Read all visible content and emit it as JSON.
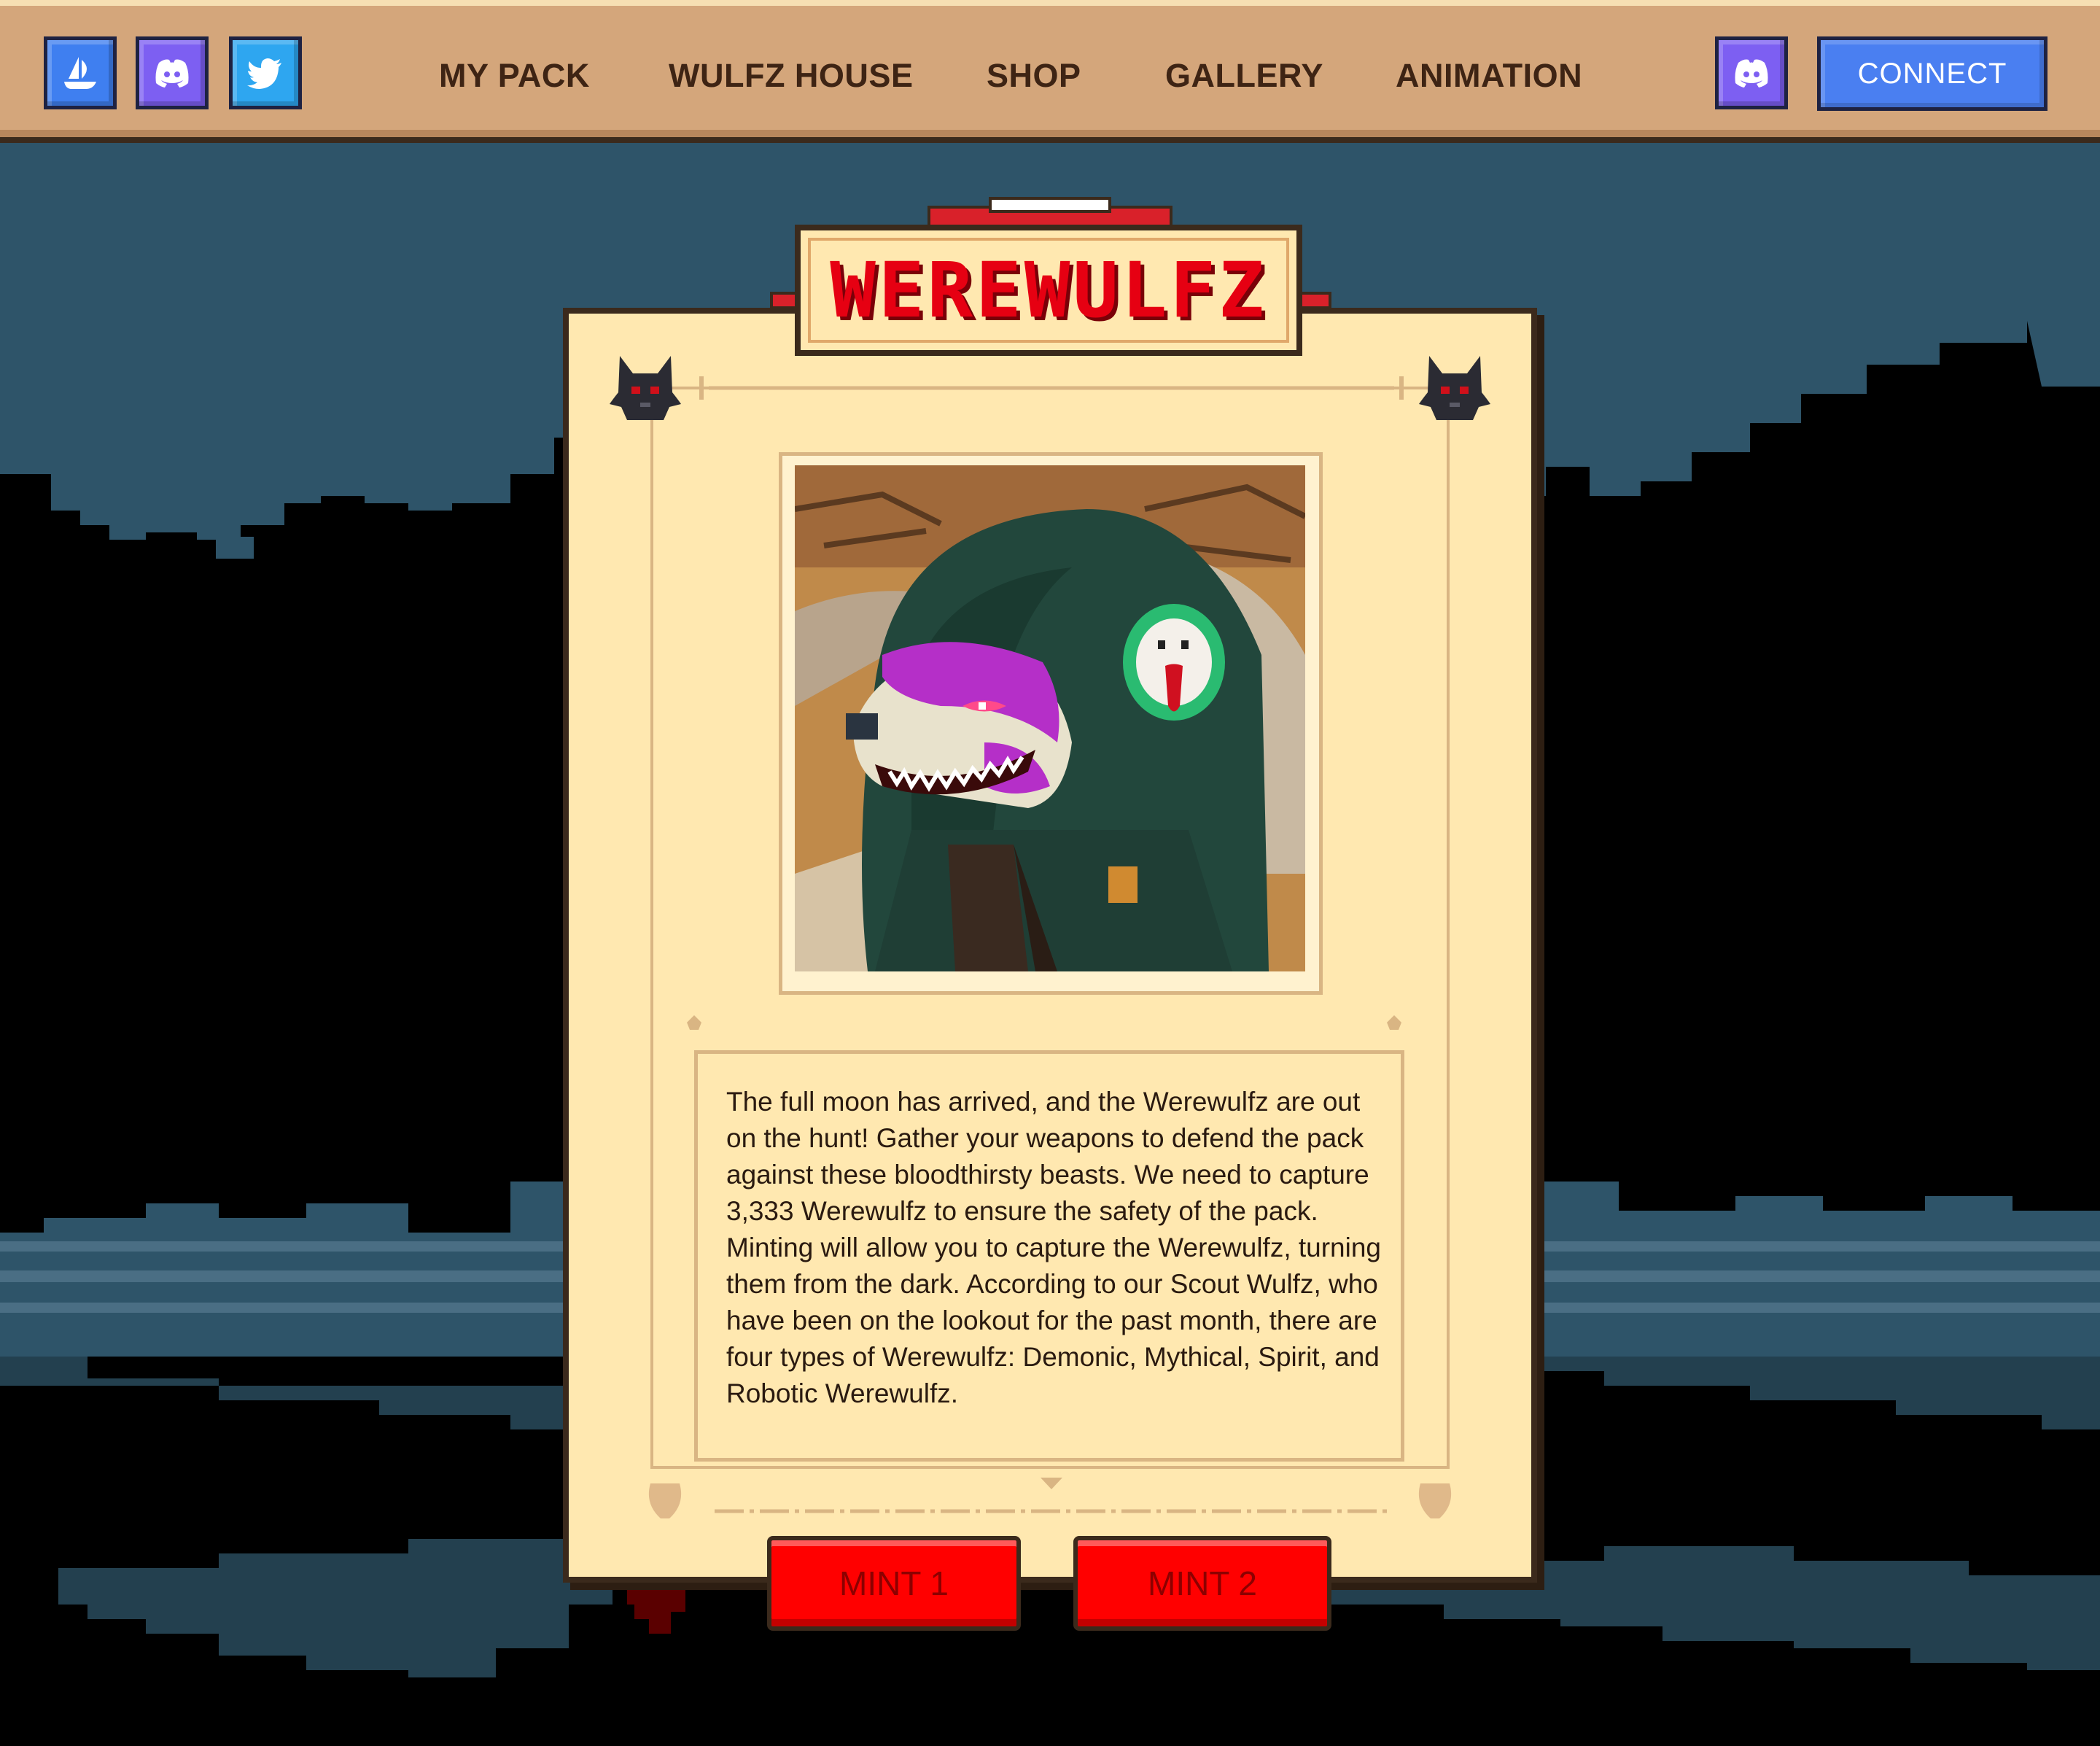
{
  "header": {
    "social_left": [
      {
        "name": "opensea",
        "color": "#3f7ff0"
      },
      {
        "name": "discord",
        "color": "#7d5ff2"
      },
      {
        "name": "twitter",
        "color": "#2ea6f0"
      }
    ],
    "nav": [
      "MY PACK",
      "WULFZ HOUSE",
      "SHOP",
      "GALLERY",
      "ANIMATION"
    ],
    "discord_right_color": "#7d5ff2",
    "connect_label": "CONNECT"
  },
  "card": {
    "title": "WEREWULFZ",
    "description": "The full moon has arrived, and the Werewulfz are out on the hunt! Gather your weapons to defend the pack against these bloodthirsty beasts. We need to capture 3,333 Werewulfz to ensure the safety of the pack. Minting will allow you to capture the Werewulfz, turning them from the dark. According to our Scout Wulfz, who have been on the lookout for the past month, there are four types of Werewulfz: Demonic, Mythical, Spirit, and Robotic Werewulfz.",
    "mint_buttons": [
      "MINT 1",
      "MINT 2"
    ]
  },
  "colors": {
    "header_bg": "#d4a67b",
    "card_bg": "#ffe8b0",
    "title_red": "#e60012",
    "mint_red": "#ff0000",
    "connect_blue": "#4a7ff1",
    "sky": "#2e5469"
  }
}
